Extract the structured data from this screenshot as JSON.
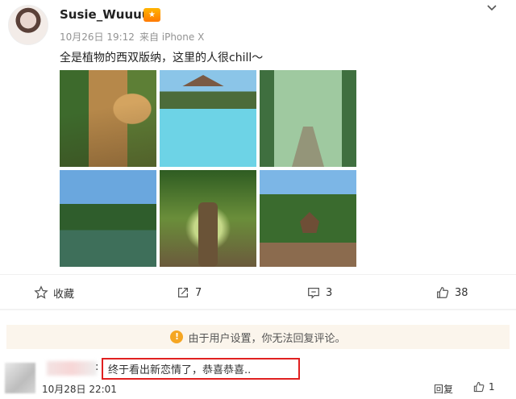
{
  "post": {
    "username": "Susie_Wuuuu",
    "date": "10月26日 19:12",
    "source": "来自 iPhone X",
    "text": "全是植物的西双版纳，这里的人很chill～",
    "photos": [
      "photo-1",
      "photo-2",
      "photo-3",
      "photo-4",
      "photo-5",
      "photo-6"
    ]
  },
  "actions": {
    "favorite_label": "收藏",
    "share_count": "7",
    "comment_count": "3",
    "like_count": "38"
  },
  "notice": {
    "text": "由于用户设置，你无法回复评论。",
    "icon": "exclamation-icon"
  },
  "comment": {
    "colon": ":",
    "text": "终于看出新恋情了，恭喜恭喜..",
    "time": "10月28日 22:01",
    "reply_label": "回复",
    "like_count": "1"
  },
  "colors": {
    "highlight_border": "#e02020",
    "notice_bg": "#fbf5ec",
    "notice_icon": "#f5a623",
    "badge": "#ff8a00"
  }
}
